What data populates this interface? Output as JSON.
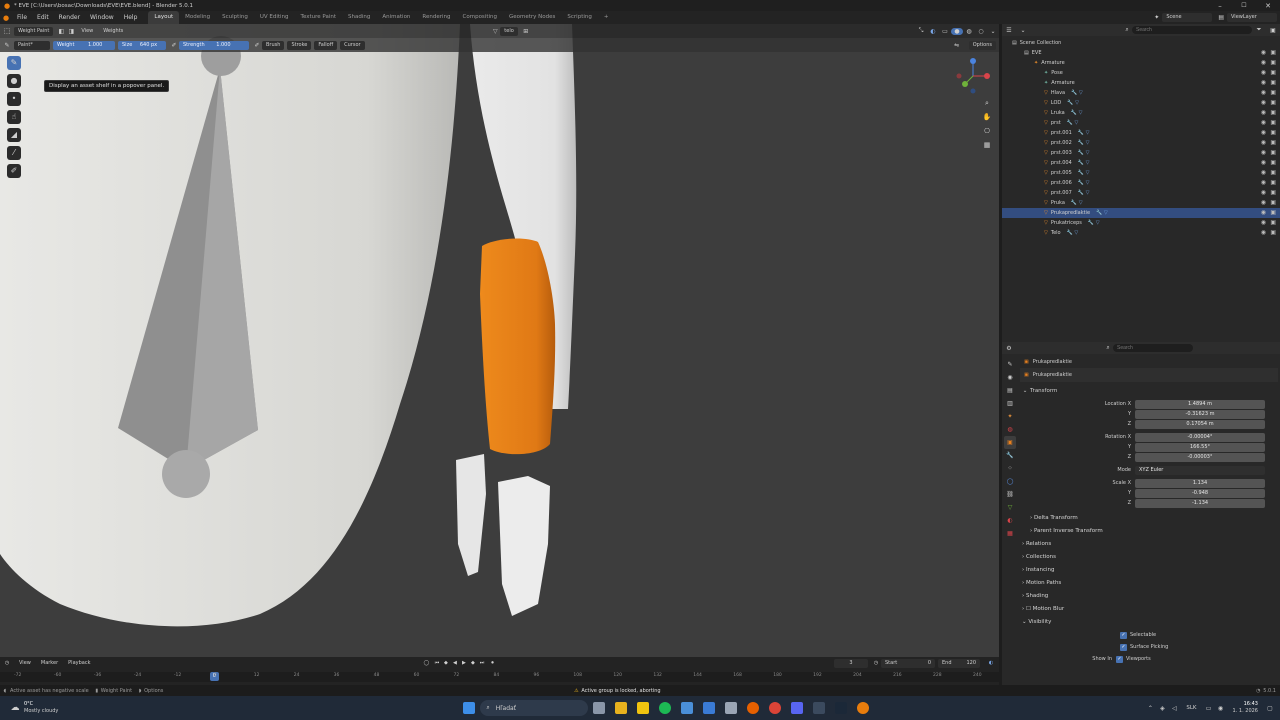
{
  "window": {
    "title": "* EVE [C:\\Users\\bosac\\Downloads\\EVE\\EVE.blend] - Blender 5.0.1"
  },
  "menubar": {
    "menus": [
      "File",
      "Edit",
      "Render",
      "Window",
      "Help"
    ],
    "workspaces": [
      "Layout",
      "Modeling",
      "Sculpting",
      "UV Editing",
      "Texture Paint",
      "Shading",
      "Animation",
      "Rendering",
      "Compositing",
      "Geometry Nodes",
      "Scripting"
    ],
    "scene": "Scene",
    "view_layer": "ViewLayer"
  },
  "viewport": {
    "mode": "Weight Paint",
    "view_menu": "View",
    "weights_menu": "Weights",
    "brush_asset": "Paint*",
    "weight_label": "Weight",
    "weight_value": "1.000",
    "size_label": "Size",
    "size_value": "640 px",
    "strength_label": "Strength",
    "strength_value": "1.000",
    "brush_menu": "Brush",
    "stroke_menu": "Stroke",
    "falloff_menu": "Falloff",
    "cursor_menu": "Cursor",
    "object_name": "telo",
    "options_label": "Options",
    "tooltip": "Display an asset shelf in a popover panel.",
    "accent_color": "#e8801e"
  },
  "outliner": {
    "search_placeholder": "Search",
    "title": "Scene Collection",
    "rows": [
      {
        "label": "EVE",
        "indent": 0,
        "sel": false,
        "icon": "collection-icon"
      },
      {
        "label": "Armature",
        "indent": 1,
        "sel": false,
        "icon": "armature-icon"
      },
      {
        "label": "Pose",
        "indent": 2,
        "sel": false,
        "icon": "pose-icon"
      },
      {
        "label": "Armature",
        "indent": 2,
        "sel": false,
        "icon": "armature-data-icon"
      },
      {
        "label": "Hlava",
        "indent": 2,
        "sel": false,
        "icon": "mesh-icon"
      },
      {
        "label": "LOD",
        "indent": 2,
        "sel": false,
        "icon": "mesh-icon"
      },
      {
        "label": "Lruka",
        "indent": 2,
        "sel": false,
        "icon": "mesh-icon"
      },
      {
        "label": "prst",
        "indent": 2,
        "sel": false,
        "icon": "mesh-icon"
      },
      {
        "label": "prst.001",
        "indent": 2,
        "sel": false,
        "icon": "mesh-icon"
      },
      {
        "label": "prst.002",
        "indent": 2,
        "sel": false,
        "icon": "mesh-icon"
      },
      {
        "label": "prst.003",
        "indent": 2,
        "sel": false,
        "icon": "mesh-icon"
      },
      {
        "label": "prst.004",
        "indent": 2,
        "sel": false,
        "icon": "mesh-icon"
      },
      {
        "label": "prst.005",
        "indent": 2,
        "sel": false,
        "icon": "mesh-icon"
      },
      {
        "label": "prst.006",
        "indent": 2,
        "sel": false,
        "icon": "mesh-icon"
      },
      {
        "label": "prst.007",
        "indent": 2,
        "sel": false,
        "icon": "mesh-icon"
      },
      {
        "label": "Pruka",
        "indent": 2,
        "sel": false,
        "icon": "mesh-icon"
      },
      {
        "label": "Prukapredlaktie",
        "indent": 2,
        "sel": true,
        "icon": "mesh-icon"
      },
      {
        "label": "Prukatriceps",
        "indent": 2,
        "sel": false,
        "icon": "mesh-icon"
      },
      {
        "label": "Telo",
        "indent": 2,
        "sel": false,
        "icon": "mesh-icon"
      }
    ]
  },
  "properties": {
    "search_placeholder": "Search",
    "breadcrumb": "Prukapredlaktie",
    "object_name": "Prukapredlaktie",
    "transform_title": "Transform",
    "location": {
      "label": "Location X",
      "x": "1.4894 m",
      "y": "-0.31623 m",
      "z": "0.17054 m"
    },
    "rotation": {
      "label": "Rotation X",
      "x": "-0.00004°",
      "y": "166.55°",
      "z": "-0.00003°"
    },
    "mode_label": "Mode",
    "mode_value": "XYZ Euler",
    "scale": {
      "label": "Scale X",
      "x": "1.134",
      "y": "-0.948",
      "z": "-1.134"
    },
    "axis_y": "Y",
    "axis_z": "Z",
    "sections": [
      "Delta Transform",
      "Parent Inverse Transform",
      "Relations",
      "Collections",
      "Instancing",
      "Motion Paths",
      "Shading",
      "Motion Blur",
      "Visibility"
    ],
    "selectable": "Selectable",
    "surface_picking": "Surface Picking",
    "show_in": "Show In",
    "viewports": "Viewports"
  },
  "timeline": {
    "menus": [
      "View",
      "Marker",
      "Playback"
    ],
    "current_frame": "3",
    "start_label": "Start",
    "start_value": "0",
    "end_label": "End",
    "end_value": "120",
    "ticks": [
      "-72",
      "-60",
      "-36",
      "-24",
      "-12",
      "0",
      "12",
      "24",
      "36",
      "48",
      "60",
      "72",
      "84",
      "96",
      "108",
      "120",
      "132",
      "144",
      "168",
      "180",
      "192",
      "204",
      "216",
      "228",
      "240"
    ],
    "playhead_frame": "0"
  },
  "statusbar": {
    "left1": "Active asset has negative scale",
    "left2": "Weight Paint",
    "left3": "Options",
    "warning": "Active group is locked, aborting",
    "version": "5.0.1"
  },
  "taskbar": {
    "weather_temp": "0°C",
    "weather_desc": "Mostly cloudy",
    "search": "Hľadať",
    "lang": "SLK",
    "time": "16:43",
    "date": "1. 1. 2026"
  }
}
